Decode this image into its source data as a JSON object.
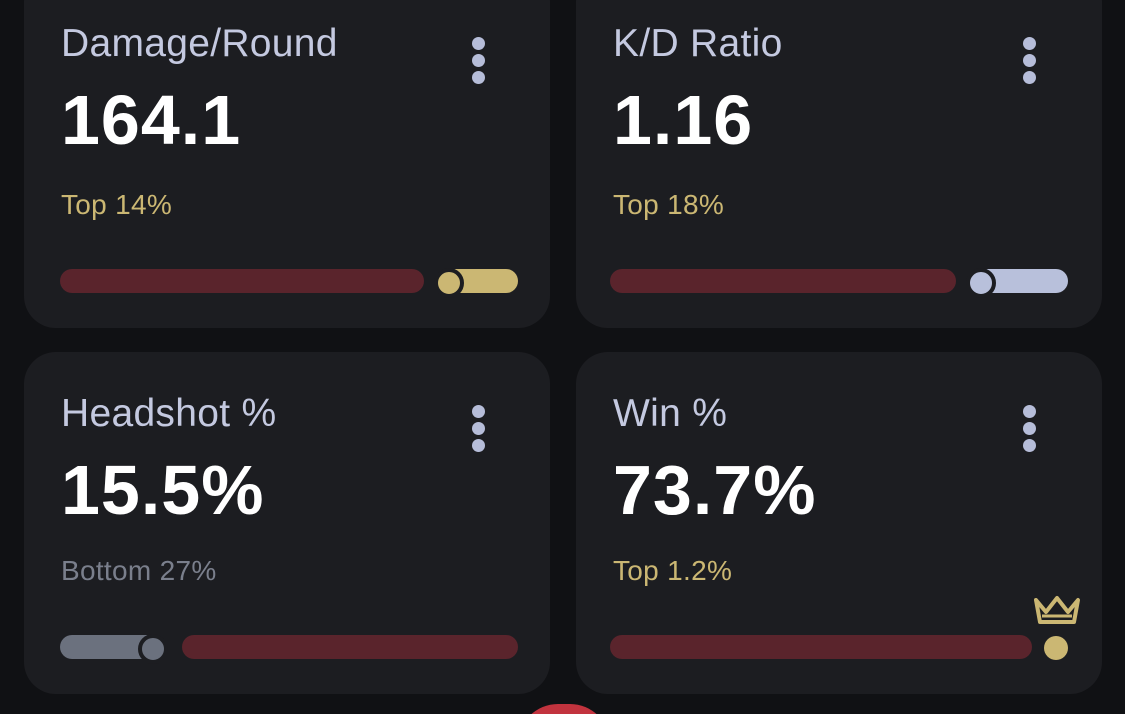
{
  "colors": {
    "background": "#101114",
    "card": "#1c1d21",
    "title": "#c4c9e0",
    "value": "#ffffff",
    "rank_gold": "#cbb773",
    "rank_gray": "#7a7f8c",
    "bar_red": "#5a242c",
    "bar_gold": "#cbb773",
    "bar_lavender": "#b8c0db",
    "bar_gray": "#6b717e",
    "accent_red": "#c2333e"
  },
  "stats": [
    {
      "title": "Damage/Round",
      "value": "164.1",
      "rank": "Top 14%",
      "rank_color": "gold",
      "percentile_position": 0.86,
      "menu_icon": "more-vertical-icon"
    },
    {
      "title": "K/D Ratio",
      "value": "1.16",
      "rank": "Top 18%",
      "rank_color": "gold",
      "percentile_position": 0.82,
      "menu_icon": "more-vertical-icon"
    },
    {
      "title": "Headshot %",
      "value": "15.5%",
      "rank": "Bottom 27%",
      "rank_color": "gray",
      "percentile_position": 0.27,
      "menu_icon": "more-vertical-icon"
    },
    {
      "title": "Win %",
      "value": "73.7%",
      "rank": "Top 1.2%",
      "rank_color": "gold",
      "percentile_position": 0.988,
      "menu_icon": "more-vertical-icon",
      "badge_icon": "crown-icon"
    }
  ]
}
